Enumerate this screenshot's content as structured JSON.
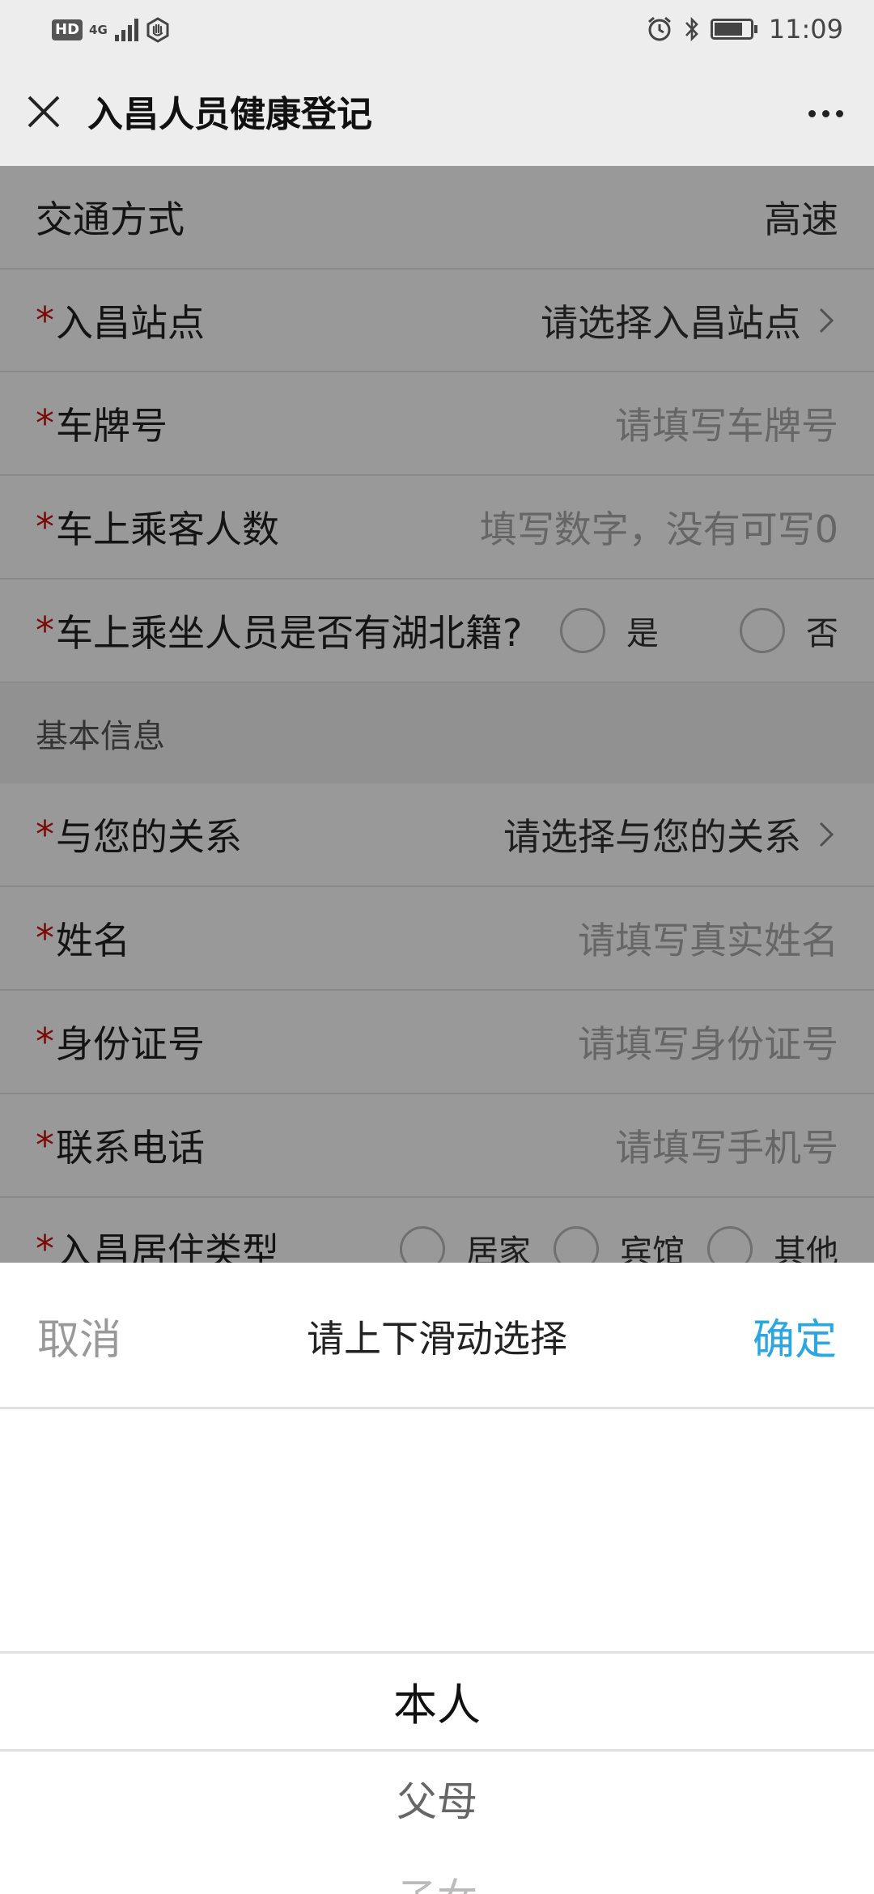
{
  "status_bar": {
    "hd": "HD",
    "network": "4G",
    "time": "11:09"
  },
  "nav": {
    "title": "入昌人员健康登记"
  },
  "form": {
    "transport": {
      "label": "交通方式",
      "value": "高速"
    },
    "station": {
      "label": "入昌站点",
      "placeholder": "请选择入昌站点"
    },
    "plate": {
      "label": "车牌号",
      "placeholder": "请填写车牌号"
    },
    "passengers": {
      "label": "车上乘客人数",
      "placeholder": "填写数字，没有可写0"
    },
    "hubei": {
      "label": "车上乘坐人员是否有湖北籍?",
      "options": [
        "是",
        "否"
      ]
    },
    "section_basic": "基本信息",
    "relation": {
      "label": "与您的关系",
      "placeholder": "请选择与您的关系"
    },
    "name": {
      "label": "姓名",
      "placeholder": "请填写真实姓名"
    },
    "id_number": {
      "label": "身份证号",
      "placeholder": "请填写身份证号"
    },
    "phone": {
      "label": "联系电话",
      "placeholder": "请填写手机号"
    },
    "residence": {
      "label": "入昌居住类型",
      "options": [
        "居家",
        "宾馆",
        "其他"
      ]
    }
  },
  "required_mark": "*",
  "picker": {
    "cancel": "取消",
    "title": "请上下滑动选择",
    "confirm": "确定",
    "options": [
      "本人",
      "父母",
      "子女"
    ],
    "selected": "本人"
  },
  "colors": {
    "accent": "#2aa7e0",
    "required": "#d01010",
    "header_bg": "#ededed"
  }
}
